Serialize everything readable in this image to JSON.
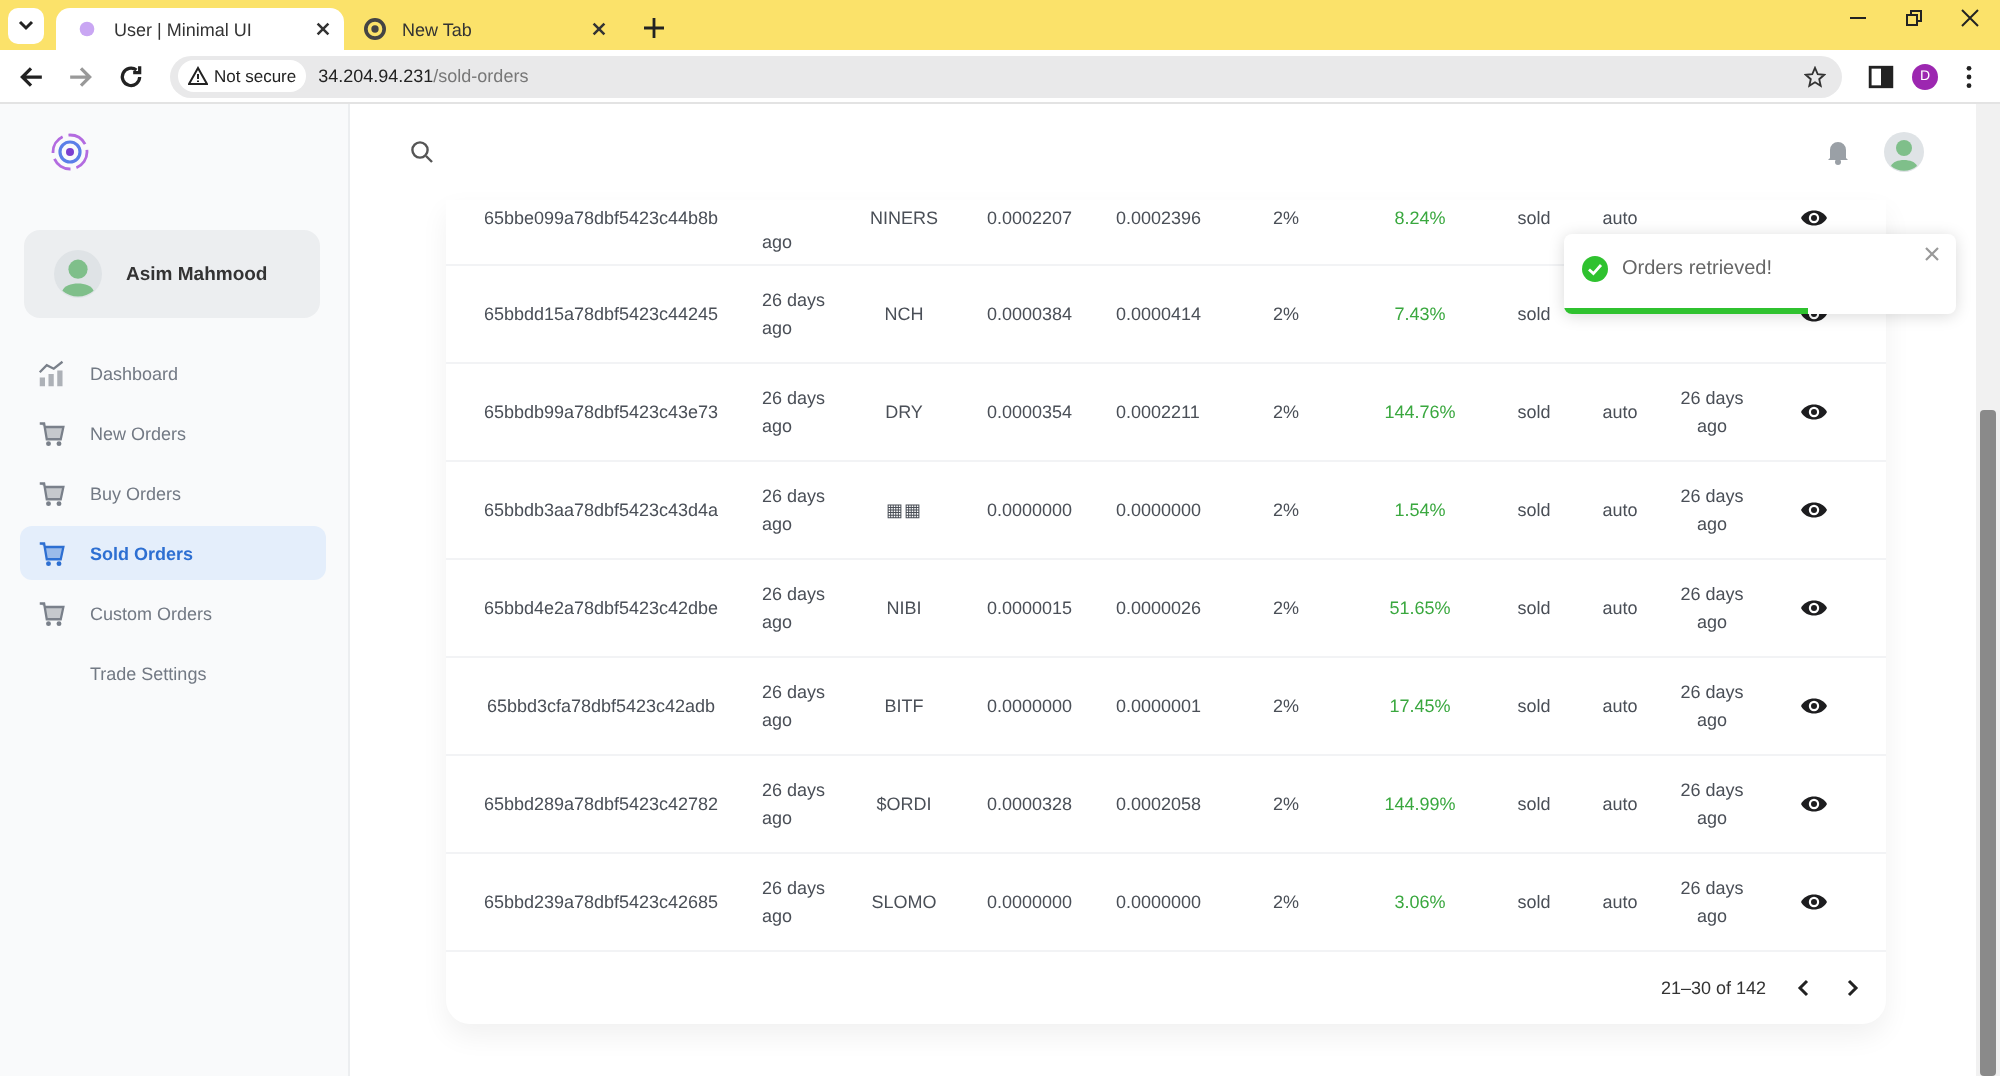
{
  "browser": {
    "tabs": [
      {
        "title": "User | Minimal UI",
        "selected": true
      },
      {
        "title": "New Tab",
        "selected": false
      }
    ],
    "not_secure": "Not secure",
    "url_host": "34.204.94.231",
    "url_path": "/sold-orders",
    "profile": "D"
  },
  "sidebar": {
    "user": "Asim Mahmood",
    "items": [
      {
        "label": "Dashboard",
        "kind": "chart",
        "selected": false
      },
      {
        "label": "New Orders",
        "kind": "cart",
        "selected": false
      },
      {
        "label": "Buy Orders",
        "kind": "cart",
        "selected": false
      },
      {
        "label": "Sold Orders",
        "kind": "cart",
        "selected": true
      },
      {
        "label": "Custom Orders",
        "kind": "cart",
        "selected": false
      },
      {
        "label": "Trade Settings",
        "kind": "none",
        "selected": false
      }
    ]
  },
  "table": {
    "rows": [
      {
        "id": "65bbe099a78dbf5423c44b8b",
        "created": "ago",
        "token": "NINERS",
        "buy": "0.0002207",
        "sell": "0.0002396",
        "fee": "2%",
        "profit": "8.24%",
        "status": "sold",
        "mode": "auto"
      },
      {
        "id": "65bbdd15a78dbf5423c44245",
        "created": "26 days ago",
        "token": "NCH",
        "buy": "0.0000384",
        "sell": "0.0000414",
        "fee": "2%",
        "profit": "7.43%",
        "status": "sold"
      },
      {
        "id": "65bbdb99a78dbf5423c43e73",
        "created": "26 days ago",
        "token": "DRY",
        "buy": "0.0000354",
        "sell": "0.0002211",
        "fee": "2%",
        "profit": "144.76%",
        "status": "sold",
        "mode": "auto",
        "updated": "26 days ago"
      },
      {
        "id": "65bbdb3aa78dbf5423c43d4a",
        "created": "26 days ago",
        "token": "▦▦",
        "buy": "0.0000000",
        "sell": "0.0000000",
        "fee": "2%",
        "profit": "1.54%",
        "status": "sold",
        "mode": "auto",
        "updated": "26 days ago"
      },
      {
        "id": "65bbd4e2a78dbf5423c42dbe",
        "created": "26 days ago",
        "token": "NIBI",
        "buy": "0.0000015",
        "sell": "0.0000026",
        "fee": "2%",
        "profit": "51.65%",
        "status": "sold",
        "mode": "auto",
        "updated": "26 days ago"
      },
      {
        "id": "65bbd3cfa78dbf5423c42adb",
        "created": "26 days ago",
        "token": "BITF",
        "buy": "0.0000000",
        "sell": "0.0000001",
        "fee": "2%",
        "profit": "17.45%",
        "status": "sold",
        "mode": "auto",
        "updated": "26 days ago"
      },
      {
        "id": "65bbd289a78dbf5423c42782",
        "created": "26 days ago",
        "token": "$ORDI",
        "buy": "0.0000328",
        "sell": "0.0002058",
        "fee": "2%",
        "profit": "144.99%",
        "status": "sold",
        "mode": "auto",
        "updated": "26 days ago"
      },
      {
        "id": "65bbd239a78dbf5423c42685",
        "created": "26 days ago",
        "token": "SLOMO",
        "buy": "0.0000000",
        "sell": "0.0000000",
        "fee": "2%",
        "profit": "3.06%",
        "status": "sold",
        "mode": "auto",
        "updated": "26 days ago"
      }
    ],
    "pagination": "21–30 of 142"
  },
  "toast": {
    "message": "Orders retrieved!",
    "level": 0.62
  }
}
